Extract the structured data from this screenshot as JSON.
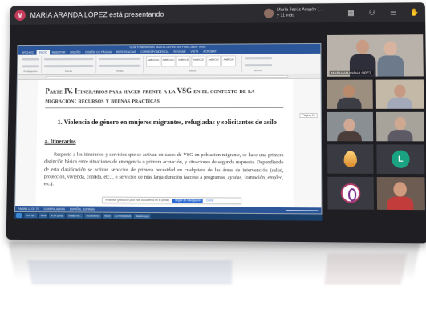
{
  "presenting_bar": {
    "avatar_initial": "M",
    "title": "MARIA ARANDA LÓPEZ está presentando",
    "presenter_name": "María Jesús Aragón (...",
    "presenter_extra": "y 11 más",
    "icons": [
      "grid-view-icon",
      "people-icon",
      "chat-icon",
      "raise-hand-icon"
    ]
  },
  "word": {
    "window_title": "GUIA ITINERARIOS MOTOS DEFINITIVA FINAL.docx - Word",
    "tabs": [
      "ARCHIVO",
      "INICIO",
      "INSERTAR",
      "DISEÑO",
      "DISEÑO DE PÁGINA",
      "REFERENCIAS",
      "CORRESPONDENCIA",
      "REVISAR",
      "VISTA",
      "ACROBAT"
    ],
    "active_tab": "INICIO",
    "ribbon_groups": [
      "Portapapeles",
      "Fuente",
      "Párrafo",
      "Estilos",
      "Edición"
    ],
    "styles": [
      "AaBbCcDc",
      "AaBbCcDc",
      "AaBbCcD",
      "AaBbCcD",
      "AaBbCcD",
      "AaBbCcD"
    ],
    "page_tag": "Página 14",
    "heading": "Parte IV. Itinerarios para hacer frente a la VSG en el contexto de la migración: recursos y buenas prácticas",
    "section_title": "1.   Violencia de género en mujeres migrantes, refugiadas y solicitantes de asilo",
    "subsection_title": "a.   Itinerarios",
    "paragraph": "Respecto a los itinerarios y servicios que se activan en casos de VSG en población migrante, se hace una primera distinción básica entre situaciones de emergencia o primera actuación, y situaciones de segunda respuesta. Dependiendo de esta clasificación se activan servicios de primera necesidad en cualquiera de las áreas de intervención (salud, protección, vivienda, comida, etc.), o servicios de más larga duración (acceso a programas, ayudas, formación, empleo, etc.).",
    "translate_bar": {
      "text": "Inhabilitar grabación para este documento en el portátil",
      "primary": "Seguir de navegación",
      "secondary": "Cerrar"
    },
    "status": [
      "PÁGINA 14 DE 70",
      "12345 PALABRAS",
      "ESPAÑOL (ESPAÑA)"
    ]
  },
  "taskbar_items": [
    "Pick up...",
    "Word",
    "VOM group",
    "Trabajo mo...",
    "Documentos",
    "Word",
    "ACTIVIDADES",
    "Metodología"
  ],
  "participants": [
    {
      "name": "MARIA ARANDA LÓPEZ",
      "kind": "video"
    },
    {
      "name": "",
      "kind": "video"
    },
    {
      "name": "",
      "kind": "video"
    },
    {
      "name": "",
      "kind": "video"
    },
    {
      "name": "",
      "kind": "video"
    },
    {
      "name": "",
      "kind": "video"
    },
    {
      "name": "",
      "kind": "avatar-egg"
    },
    {
      "name": "",
      "kind": "initial",
      "initial": "L"
    },
    {
      "name": "",
      "kind": "logo"
    },
    {
      "name": "",
      "kind": "video"
    }
  ],
  "colors": {
    "teams_bar": "#2b2b30",
    "word_blue": "#2b579a",
    "initial_badge": "#1aa382",
    "presenter_avatar": "#c43b5b"
  }
}
